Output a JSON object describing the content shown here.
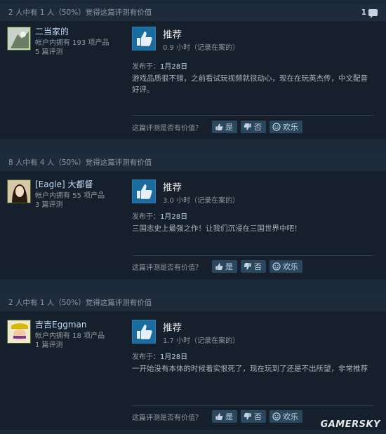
{
  "helpful_prompt": "这篇评测是否有价值？",
  "yes_label": "是",
  "no_label": "否",
  "funny_label": "欢乐",
  "posted_label": "发布于：",
  "verdict": "推荐",
  "reviews": [
    {
      "helpful_summary": "2 人中有 1 人（50%）觉得这篇评测有价值",
      "comment_count": "1",
      "author_name": "二当家的",
      "products": "帐户内拥有 193 项产品",
      "review_count": "5 篇评测",
      "hours": "0.9 小时（记录在案的）",
      "date": "1月28日",
      "text": "游戏品质很不错，之前看试玩视频就很动心，现在在玩英杰传，中文配音好评。"
    },
    {
      "helpful_summary": "8 人中有 4 人（50%）觉得这篇评测有价值",
      "author_name": "[Eagle] 大都督",
      "products": "帐户内拥有 55 项产品",
      "review_count": "3 篇评测",
      "hours": "3.0 小时（记录在案的）",
      "date": "1月28日",
      "text": "三国志史上最强之作！让我们沉浸在三国世界中吧！"
    },
    {
      "helpful_summary": "2 人中有 1 人（50%）觉得这篇评测有价值",
      "author_name": "吉吉Eggman",
      "products": "帐户内拥有 18 项产品",
      "review_count": "1 篇评测",
      "hours": "1.7 小时（记录在案的）",
      "date": "1月28日",
      "text": "一开始没有本体的时候着实恨死了，现在玩到了还是不出所望，非常推荐"
    }
  ],
  "watermark": "GAMERSKY"
}
